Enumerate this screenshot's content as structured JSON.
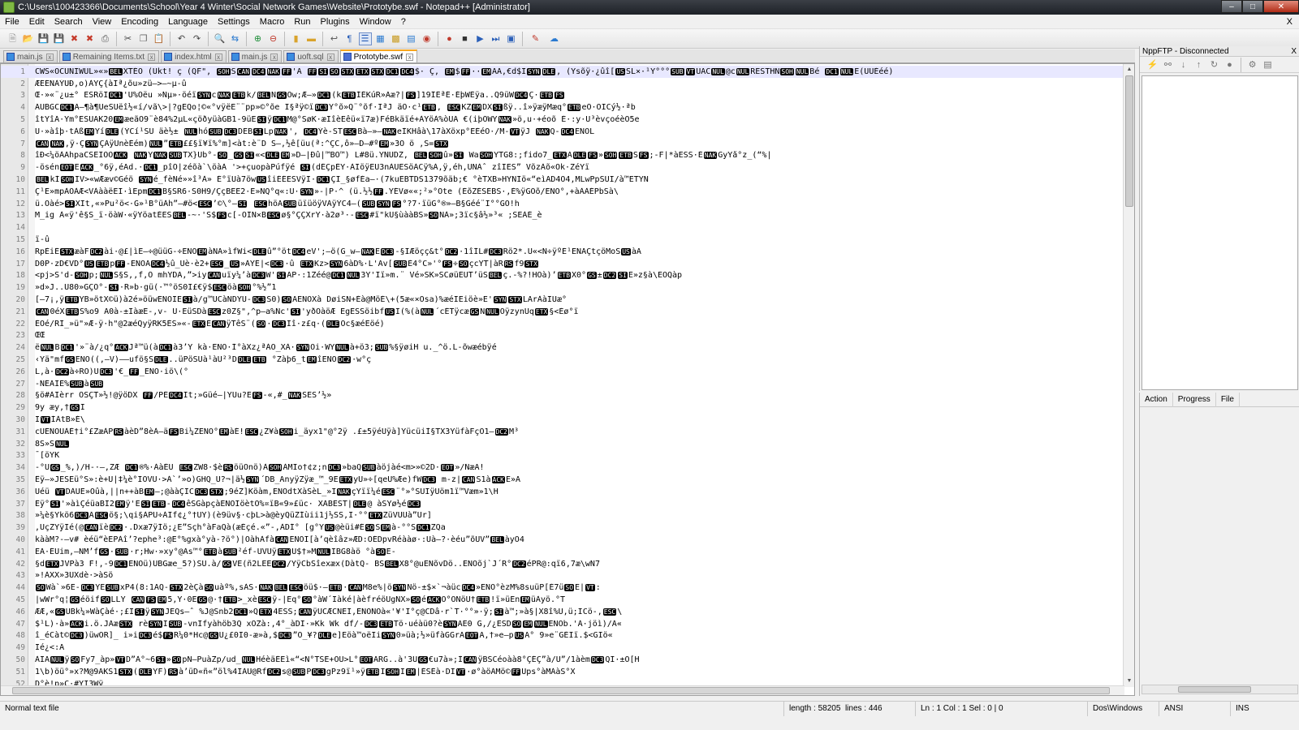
{
  "window": {
    "title": "C:\\Users\\100423366\\Documents\\School\\Year 4 Winter\\Social Network Games\\Website\\Prototybe.swf - Notepad++ [Administrator]"
  },
  "menu": [
    "File",
    "Edit",
    "Search",
    "View",
    "Encoding",
    "Language",
    "Settings",
    "Macro",
    "Run",
    "Plugins",
    "Window",
    "?"
  ],
  "menu_close": "X",
  "tabs": [
    {
      "label": "main.js",
      "active": false
    },
    {
      "label": "Remaining Items.txt",
      "active": false
    },
    {
      "label": "index.html",
      "active": false
    },
    {
      "label": "main.js",
      "active": false
    },
    {
      "label": "uoft.sql",
      "active": false
    },
    {
      "label": "Prototybe.swf",
      "active": true
    }
  ],
  "editor": {
    "lines": [
      {
        "n": "1",
        "text": "CWS«ÓCUNIWUL»«»BELXTÉÓ (Ûkt! ç (QF\", SOHSCANDC4NAKFF'Ä FFSISOSTXETXSTXDC1DC4$· Ç, EM$FF··EMAA,€d$ISYNDLE, (Ysõÿ·¿ûî[USSL×·¹Y°°°SUBVTUACNUL@cNULRESTHNSOHNULBé DC1NULE(ÙÚÉéé)"
      },
      {
        "n": "2",
        "text": "ÆÉÉÑÀÝÜÐ,o)ÀYÇ{àIª¿õu»zü–>—~µ-û"
      },
      {
        "n": "3",
        "text": "Œ·»«¨¿u±° ESRöIDC1'U%Öëu »Ñµ»·öéïSYNcNAKETBk/BELNGSOw;Æ—»DC1(kETBÍÉKúR»Aæ?|FS]19ÎÉªÉ·ÉþWÉÿa..Q9üWDC4Ç·ETBFS"
      },
      {
        "n": "4",
        "text": "ÃUBGCDC1Ã—¶à¶ÚeSUëî½«í/vã\\>|?gEQo¦©«°vÿëE¨¨pp»©°õe I§ªÿ©ïDC3Y°õ»Q¨°õf·IªJ äÕ·c¹ETB, ESCKZEMDXSIßÿ..î»ÿæÿMæq°ETBeÕ·ÖICý½·ªb"
      },
      {
        "n": "5",
        "text": "îtYîÃ·Ym°ESUAK20EMæeãO9¨è84%2µL«çöðyüàGB1-9üESIÿDC1M@°SøK·æIîèEêü«ï7æ)FéBkäïé+ÀYöÀ%òUÃ €(iþÕWYNAK»ö,u·+éoõ É·:y·U³èvçoéèO5e"
      },
      {
        "n": "6",
        "text": "Ü·»àîþ·tÀßEMYíDLE(ÝCí¹SU äè½± NULhóSUBDC3DEBSILpNAK', DC4Ýè-STESCBà—»—NAKeÌKHâà\\17àXöxp°EÉéÖ·/M-VTÿJ NAKQ-DC4ENOL"
      },
      {
        "n": "7",
        "text": "CANNAK,ÿ·ÇSYNÇÀÿÛnèÉém)NUL”ETB££§ï¥ï%°m]<àt:è¨D S—,½ê[üu(ª:^ÇC,ô»—D—#ºEM»3Õ ö ,S=STX"
      },
      {
        "n": "8",
        "text": "îÐ<¼öÀAhpaCŠEIÖÖACK NAKYNAKSUBTX}Üb°-SO_GSSI«<DLEEM»D—|Ðû|™BÖ™) L#8ü.YÑUDZ, BELSOHû»SI WaSOHYTG8:;fido7_ETXADLEFS»SOHETBSFS;-F|*àESS·ÉNAKGyYå°z_(“%|"
      },
      {
        "n": "9",
        "text": "-ösénEOTEACK_°6ÿ,éAd.·DC1_pîÕ|zéõà`\\öàÀ '>+çuopàPúfÿé SI(dÉÇpÉY·ÀIöÿEU3nÀUESöÀCÿ%À,ÿ,éh,UNÀˆ  zîIES” VõzÀõ«Ök·ZéYï"
      },
      {
        "n": "10",
        "text": "BELkÍSOHIV>«wÆæv©Géö SYNé_fèNé»»î³À» É°ïÚà7öwUSîiÉÉESVÿI·DC1ÇI_§øfÉa—·(7kuEBTDS1379õäb;€ °èTXB»HYNIö«“eìAD4Ö4,MLwPpSUI/à™ETYN"
      },
      {
        "n": "11",
        "text": "Ç¹E»mpÀÕÀÆ<VÀààëËI·ìEpmDC1B§SR6·S0H9/ÇçBEE2·E»NQ°q«:Ü·SYN»-|P·^ (ü.½½FF.YÉVø««;²»°Õte (ÉõZÉSEBS·,É%ÿGÕõ/ENO°,+àÀÀÉPbSà\\"
      },
      {
        "n": "12",
        "text": "ü.Óàé>SIXIt,«»Pu²ö<·G»¹B°üÀh”—#ö<ESC’©\\°—SI ESChöASUBüïüöÿVÀÿÝC4—(SUBSYNFS°?7·ïüG°®»—B§Géé¨I°°GO!h"
      },
      {
        "n": "13",
        "text": "M_ig À«ÿ'ê§S_ï·öàW·«ÿYöatÉESBEL-~·'S$FSc[-ÖIN×BESCø§°ÇÇXrY·à2ø³·-ESC#ï\"kÜ§ùààBS»SONÀ»;3ïc§â½»³« ;SEÀÉ_è"
      },
      {
        "n": "14",
        "text": ""
      },
      {
        "n": "15",
        "text": "ï-û"
      },
      {
        "n": "16",
        "text": "RpÈiÉSTXæàFDC2ài·@£|ìE—÷@üüG-÷ENOEMàNA»ìfWi<DLEû”°ötDC4eV';—ö(G_w—NAKEDC3-§IÆöçç&t°DC2·1îÍL#DC3Rö2*.Ü«<N÷ÿºÉ¹ENAÇtçöMoSUSàA"
      },
      {
        "n": "17",
        "text": "D0P·zD€VD°USETBpFF-ENOÄDC4½û_Üè·è2+ESC_US»ÀYÉ|<DC3·û ETXKz>SYN6àD%·L'Av[SUBÈ4°C»'°FS÷SOçcYT|àRRSf9STX"
      },
      {
        "n": "18",
        "text": "<pj>S'd-SOHp;NULS§S,,f,Õ mhYDA,”>iyCANuïy¼’àDC3W'SIAP·:1Zéé@DC1NUL3Y'Iï»m.¨ Vé»SK»SCøüEUT’üSBELç.-%?!HÓà)’ETBX0°GS±DC2SIE»z§à\\EÖQàp"
      },
      {
        "n": "19",
        "text": "»d»J..U80»GÇÕ°-SI·R»b·gü(·™°öS0I£€ÿ$ESCöàSOH°%½”1"
      },
      {
        "n": "20",
        "text": "[—7¡,ÿETBYB»ötX©ü)à2é»öüwENOIESIà/g™UCàNDYU-DC3S0)SOAENOXà DøiSN+Éà@MöÉ\\+(5æ«×Ösa)%æéIEiöè»E'SYNSTXLArÀàIÜæ°"
      },
      {
        "n": "21",
        "text": "CAN0éXETBS%o9 A0à-±IàæE-,v- U·EüSDàESCz0Z§\",^p—a%Ñc'SI'yðÖàöÆ EgESSöibfUSI(%(àNUL´cÉTÿcæGSNNULOÿzynÜqETX§<Éø°ï"
      },
      {
        "n": "22",
        "text": "ÈOé/RÍ_»ü\"»Æ-ÿ·h\"@2æéQyÿRK5ÉS»«-ETXÉCANÿTêS¨(SO·DC3Iî·z£q·(DLEÖc§æéEöé)"
      },
      {
        "n": "23",
        "text": "ŒŒ"
      },
      {
        "n": "24",
        "text": "ëNULBDC1'»¨à/¿q°ACKJª™ü(àDC1à3’Y kà·ENO·Í°àXz¿ªÀÖ_XÀ·SYNOi·WYNULà+ö3;SUB%§ÿøiH u._^ö.L-õwæébÿé"
      },
      {
        "n": "25",
        "text": "‹Yä\"mfGSENO((,—V)——ufö§SDLE..üPöSUà¹àÛ²³DDLEETB °Zàþ6_tEMîENODC2·w°ç"
      },
      {
        "n": "26",
        "text": "L,à·DC2à÷RÖ)ÛDC3'€_FF_ENO·iö\\(°"
      },
      {
        "n": "27",
        "text": "-ÑÉAIÉ%SUBàSUB"
      },
      {
        "n": "28",
        "text": "§ö#ÀIèrr ÕSÇT»½!@ÿöDX FF/PÉDC4It;»Güé—|YÜu?EFS-«,#_NAKSES’½»"
      },
      {
        "n": "29",
        "text": "9y æy,†GSI"
      },
      {
        "n": "30",
        "text": "IVTÍÀtB»É\\"
      },
      {
        "n": "31",
        "text": "cUENOÜÀÈ†i°£ZæÀPRSàèD”8èÀ—äFSBi¼ZENO°EMàÉ!ESC¿Z¥àSOHi_äyx1\"@°2ÿ .£±5ÿéÜÿà]YücüiÌ§TX3YüfàFçÕ1—DC2M³"
      },
      {
        "n": "32",
        "text": "8S»SNUL"
      },
      {
        "n": "33",
        "text": "¯[öYK"
      },
      {
        "n": "34",
        "text": "-°UGS_%,)/H-·—,ZÆ DC1®%·ÀàÉU ESCZW8·$èRSöüOnö)ÀSOHÀMIo†¢z;nDC3»baQSUBàöjàé<m>»©2D·EOT»/ÑæÄ!"
      },
      {
        "n": "35",
        "text": "Êÿ—»JESEü°S»:è+U|‡¼è°IÖVU·>À`’»o)GHQ_U?¬|ä½SYN´DB_ÄnyÿZÿæ_™_9EETXyÜ»÷[qeÜ%Æe)fWDC3 m-z|CANS1àACKE»A"
      },
      {
        "n": "36",
        "text": "Uéü VTDÀUE»Öûà,||n++àBEM—;@ààÇICDC3STX;9éZ]Köàm,ENOdtXàSèL_»INAKçYïï¼éESC¨°»°SUIÿÜöm1ï™Væm»1\\H"
      },
      {
        "n": "37",
        "text": "Êÿ°SI'»àì­ÇéüaBI2EMÿ'ESIETB-DC4êSGàpçàENOIöètÓ%¤ïB«9»£üc· XÀBEST|DLE@ àSYø½éDC3"
      },
      {
        "n": "38",
        "text": "»¼è§Ykö6DC3ÃESCö§;\\qi§ÀPU÷ÀIf¢¿°†UY)(è9üv§·cþL>à@èyQüZÍùii1j½SS,I·°°ETXZüVUÜà”Ur]"
      },
      {
        "n": "39",
        "text": ",ÜçZYÿIé(@CANïèDC2·.Dxæ7ÿÍö;¿E”Sçh°àFaQà(æÉçé.«”-,ÀDÍ° [g°YUS@èüi#ÉSOSEMà-°°SDC1ZQa"
      },
      {
        "n": "40",
        "text": "kààM?-—v# èéü“èEPÀî’?ephe³:@E°%gxà°yà-?ö°)|ÖàhÀfàCANENOI[à’qèîâz»ÆD:ÖÉDpvRéààø·:Uà—?·èéu”õUV”BELàyÖ4"
      },
      {
        "n": "41",
        "text": "EA·ÉUim,—NM’fGS·SUB·r;Hw·»xy°@Às™°ETBàSUB²éf-ÛVUÿETXU$†»MNULIBG8àö °àSOE-"
      },
      {
        "n": "42",
        "text": "§dETXJVPà3 F!,-9DC1ENOü)ÜBGæe_5?)SU.à/GSVE(ñ2LEEDC2/YÿCbSîexæx(DàtQ- BSBELX8°@uENõvDö..ENOõj`J´R°DC2éPR@:qï6,7æ\\wN7"
      },
      {
        "n": "43",
        "text": "»!ÀXX»3UXdè·>àSö"
      },
      {
        "n": "44",
        "text": "SOWà`»6E-DC3YESUBxP4(8:1AQ-STX2èÇàSOuàº%,sÀS·NAKBELESCöü$·—ETB·CANM8e%|öSYNNö-±$×`¬àücDC4»ENO°èzM%8suüP[É7üSOE|VT:"
      },
      {
        "n": "45",
        "text": "|wWr°q¦GSéöifSOLLY CANFSEM5,Y·0EGS@·†ETB>_xèESCÿ-|Eq°SO°àW´Iàké|àèfréöUgNX»SOéACKO°ÖNöU†ETB!ï»üEnEMüÀyö.°T"
      },
      {
        "n": "46",
        "text": "ÆÆ,«GSUBk¼»WàÇàé·;£ISIÿSYNJEQs—ˆ  %J@Snb2DC1»QETX4ESS;CANÿUCÆCÑEI,ENONOà«'¥'I°ç@CDâ·r`T·°°»·ÿ;SIà™;»à§|X8î%U,ü;ICö-,ESC\\"
      },
      {
        "n": "47",
        "text": "$¹L)·à»ACKi.ö.JAæSTX rèSYNISUB-vnIfyàhöb3Q xÕZà:,4°_àDI·»Kk Wk df/-DC3ETBTö·uéàü0?èSYNAE0 G,/¿ESDSOEMNULENOb.'À·jöì)/À«"
      },
      {
        "n": "48",
        "text": "î_éCàt©DC3)üwOR]_ i»iDC3é$FSR¼0*Hc@GSÙ¿£0I0-æ»à,$DC3”O_¥?DLEe]Eöà™oëIiSYN0»üà;½»üfàGGrAEOTA,†»e—pUSA° 9»e¨GÉIï.$<GIö«"
      },
      {
        "n": "49",
        "text": "Ié¿<:A"
      },
      {
        "n": "50",
        "text": "ÀIANULÿSOFy7_àp»VTD”À°~6SI»SOpN—PuàZp/ud_NULHéèäÉEì«“<N°TSE+ÖU>L°EOTARG..à'3ÜGS€u7à»;ÌCANÿBSCéoàà8°ÇÉÇ”à/U”/1àèmDC3QI·±O[H"
      },
      {
        "n": "51",
        "text": "1\\b)öü°»x?M@9AKS1STX(DLEYF)RSà’üD«ñ«”öl%4IÀU@RfDC2s@SUBPDC3gPz9ï¹»ÿETBISOHIEM|ÉSÉà·DIVT·ø°àöÀMö©FFUps°àMÀàS°X"
      },
      {
        "n": "52",
        "text": "D°è!p»C·#YI3Wÿ"
      }
    ]
  },
  "ftp": {
    "title": "NppFTP - Disconnected",
    "close": "X",
    "queue_columns": [
      "Action",
      "Progress",
      "File"
    ]
  },
  "status": {
    "filetype": "Normal text file",
    "length": "length : 58205",
    "lines": "lines : 446",
    "position": "Ln : 1    Col : 1    Sel : 0 | 0",
    "eol": "Dos\\Windows",
    "encoding": "ANSI",
    "mode": "INS"
  },
  "colors": {
    "active_tab_accent": "#f7a51d",
    "control_char_bg": "#000000",
    "gutter_bg": "#e8e8e8"
  },
  "icons": [
    "new-file-icon",
    "open-file-icon",
    "save-icon",
    "save-all-icon",
    "close-icon",
    "close-all-icon",
    "print-icon",
    "cut-icon",
    "copy-icon",
    "paste-icon",
    "undo-icon",
    "redo-icon",
    "find-icon",
    "replace-icon",
    "zoom-in-icon",
    "zoom-out-icon",
    "sync-v-icon",
    "sync-h-icon",
    "wrap-icon",
    "all-chars-icon",
    "indent-guide-icon",
    "udl-icon",
    "doc-map-icon",
    "function-list-icon",
    "folder-workspace-icon",
    "record-macro-icon",
    "stop-macro-icon",
    "play-macro-icon",
    "run-macro-icon",
    "save-macro-icon",
    "spell-check-icon",
    "ftp-icon"
  ]
}
